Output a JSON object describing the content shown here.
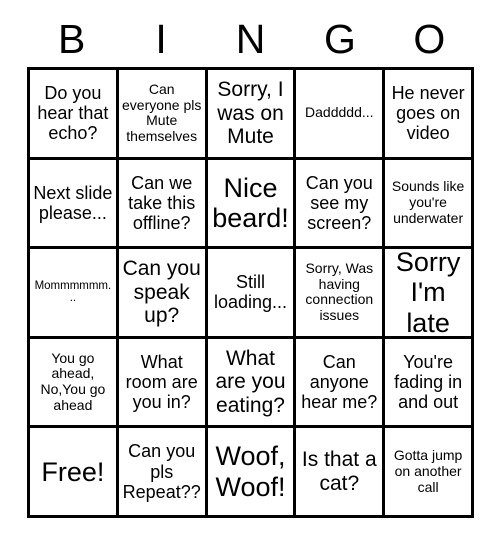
{
  "header": {
    "letters": [
      "B",
      "I",
      "N",
      "G",
      "O"
    ]
  },
  "colors": {
    "border": "#000000",
    "cell_background": "#ffffff",
    "text": "#000000",
    "page_background": "#ffffff"
  },
  "grid": {
    "rows": 5,
    "columns": 5,
    "cells": [
      {
        "text": "Do you hear that echo?",
        "size": "md"
      },
      {
        "text": "Can everyone pls Mute themselves",
        "size": "sm"
      },
      {
        "text": "Sorry, I was on Mute",
        "size": "lg"
      },
      {
        "text": "Daddddd...",
        "size": "sm"
      },
      {
        "text": "He never goes on video",
        "size": "md"
      },
      {
        "text": "Next slide please...",
        "size": "md"
      },
      {
        "text": "Can we take this offline?",
        "size": "md"
      },
      {
        "text": "Nice beard!",
        "size": "xl"
      },
      {
        "text": "Can you see my screen?",
        "size": "md"
      },
      {
        "text": "Sounds like you're underwater",
        "size": "sm"
      },
      {
        "text": "Mommmmmm...",
        "size": "xs"
      },
      {
        "text": "Can you speak up?",
        "size": "lg"
      },
      {
        "text": "Still loading...",
        "size": "md"
      },
      {
        "text": "Sorry, Was having connection issues",
        "size": "sm"
      },
      {
        "text": "Sorry I'm late",
        "size": "xl"
      },
      {
        "text": "You go ahead, No,You go ahead",
        "size": "sm"
      },
      {
        "text": "What room are you in?",
        "size": "md"
      },
      {
        "text": "What are you eating?",
        "size": "lg"
      },
      {
        "text": "Can anyone hear me?",
        "size": "md"
      },
      {
        "text": "You're fading in and out",
        "size": "md"
      },
      {
        "text": "Free!",
        "size": "xl"
      },
      {
        "text": "Can you pls Repeat??",
        "size": "md"
      },
      {
        "text": "Woof, Woof!",
        "size": "xl"
      },
      {
        "text": "Is that a cat?",
        "size": "lg"
      },
      {
        "text": "Gotta jump on another call",
        "size": "sm"
      }
    ]
  }
}
